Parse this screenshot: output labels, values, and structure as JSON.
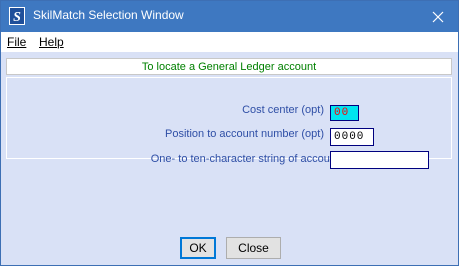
{
  "window": {
    "title": "SkilMatch Selection Window",
    "app_icon_glyph": "S"
  },
  "menu": {
    "file": "File",
    "help": "Help"
  },
  "header": {
    "text": "To locate a General Ledger account"
  },
  "form": {
    "cost_center_label": "Cost center (opt)",
    "cost_center_value": "00",
    "position_label": "Position to account number (opt)",
    "position_value": "0000",
    "description_label": "One- to ten-character string of account description (opt)",
    "description_value": ""
  },
  "buttons": {
    "ok": "OK",
    "close": "Close"
  },
  "colors": {
    "titlebar": "#3e78c1",
    "window_bg": "#d9e1f6",
    "label_text": "#2f4fa6",
    "header_text": "#008000",
    "cost_field_bg": "#00e5f0",
    "cost_field_text": "#ff0000",
    "field_border": "#00007f"
  }
}
